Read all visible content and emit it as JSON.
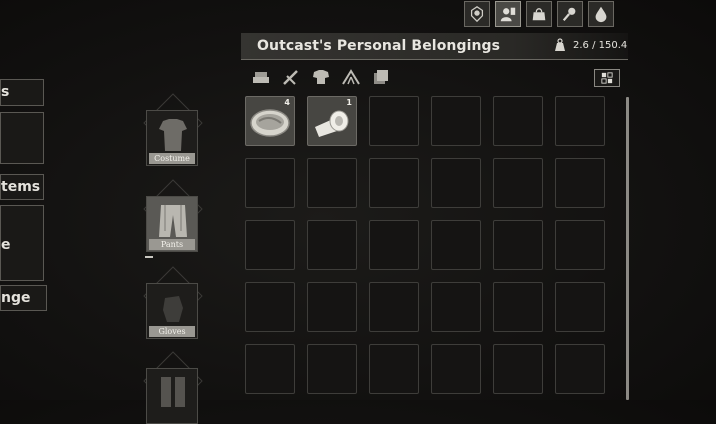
{
  "top_icons": [
    {
      "name": "character-icon",
      "active": false
    },
    {
      "name": "inventory-icon",
      "active": true
    },
    {
      "name": "storage-icon",
      "active": false
    },
    {
      "name": "skills-icon",
      "active": false
    },
    {
      "name": "water-drop-icon",
      "active": false
    }
  ],
  "left_tabs": [
    {
      "label": "s"
    },
    {
      "label": ""
    },
    {
      "label": "tems"
    },
    {
      "label": "e"
    },
    {
      "label": "nge"
    }
  ],
  "panel": {
    "title": "Outcast's Personal Belongings",
    "weight": "2.6 / 150.4"
  },
  "filters": [
    "materials-icon",
    "weapons-icon",
    "armor-icon",
    "camp-icon",
    "misc-icon"
  ],
  "equipment": [
    {
      "label": "Costume"
    },
    {
      "label": "Pants"
    },
    {
      "label": "Gloves"
    },
    {
      "label": ""
    }
  ],
  "items": [
    {
      "slot": 0,
      "name": "bowl-of-food",
      "count": "4"
    },
    {
      "slot": 1,
      "name": "bandage",
      "count": "1"
    }
  ]
}
